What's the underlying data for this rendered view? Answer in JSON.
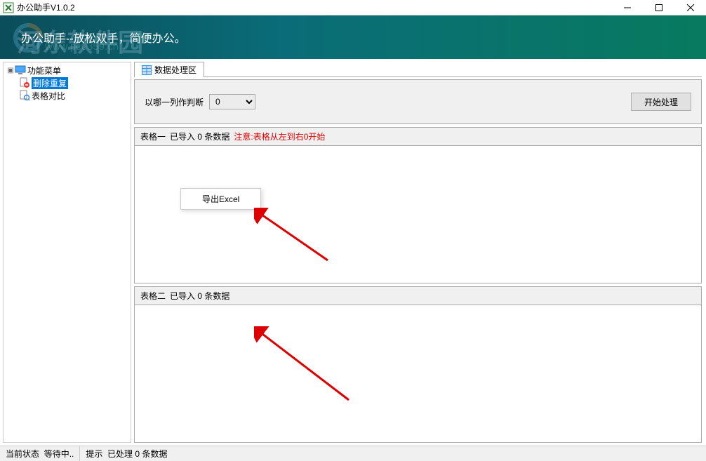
{
  "window": {
    "title": "办公助手V1.0.2"
  },
  "header": {
    "slogan": "办公助手--放松双手，简便办公。",
    "watermark": "河东软件园",
    "watermark_sub": "www.pc0359.cn"
  },
  "sidebar": {
    "root": "功能菜单",
    "items": [
      {
        "label": "删除重复",
        "selected": true
      },
      {
        "label": "表格对比",
        "selected": false
      }
    ]
  },
  "tab": {
    "label": "数据处理区"
  },
  "controls": {
    "judge_label": "以哪一列作判断",
    "selected_column": "0",
    "start_button": "开始处理"
  },
  "table1": {
    "title": "表格一",
    "imported_prefix": "已导入",
    "count": "0",
    "imported_suffix": "条数据",
    "notice": "注意:表格从左到右0开始"
  },
  "table2": {
    "title": "表格二",
    "imported_prefix": "已导入",
    "count": "0",
    "imported_suffix": "条数据"
  },
  "context_menu": {
    "export": "导出Excel"
  },
  "statusbar": {
    "state_label": "当前状态",
    "state_value": "等待中..",
    "hint_label": "提示",
    "processed_prefix": "已处理",
    "processed_count": "0",
    "processed_suffix": "条数据"
  }
}
